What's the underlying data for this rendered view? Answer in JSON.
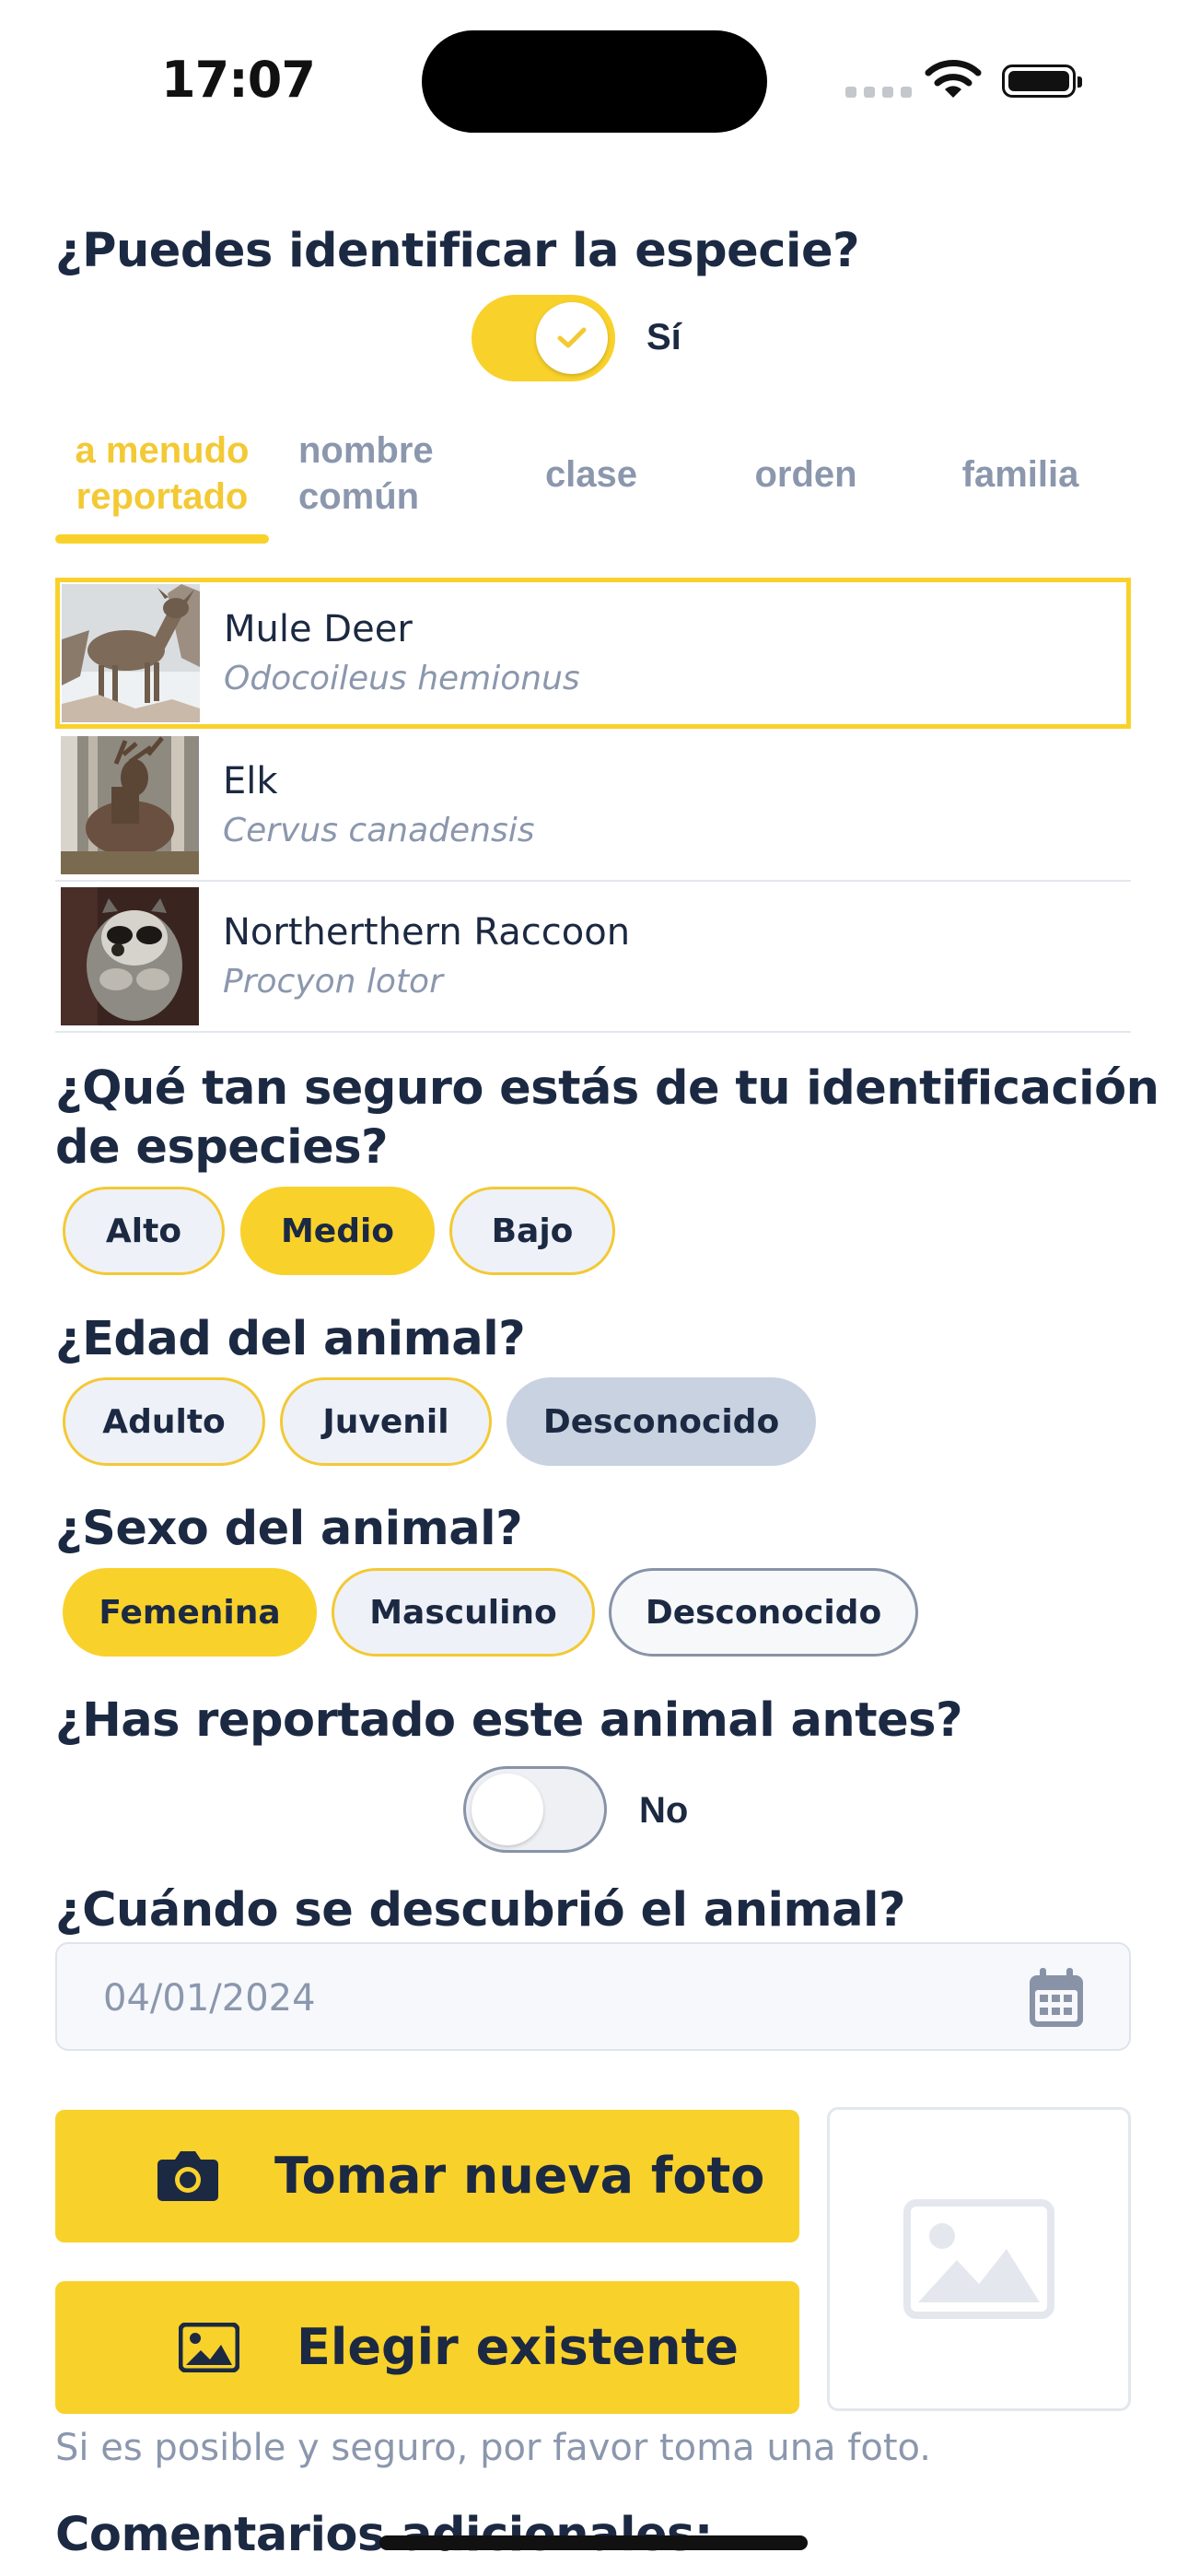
{
  "status_bar": {
    "time": "17:07"
  },
  "identify": {
    "question": "¿Puedes identificar la especie?",
    "toggle_on": true,
    "toggle_label": "Sí"
  },
  "tabs": [
    {
      "line1": "a menudo",
      "line2": "reportado",
      "active": true
    },
    {
      "line1": "nombre",
      "line2": "común",
      "active": false
    },
    {
      "label": "clase",
      "active": false
    },
    {
      "label": "orden",
      "active": false
    },
    {
      "label": "familia",
      "active": false
    }
  ],
  "species": [
    {
      "name": "Mule Deer",
      "scientific": "Odocoileus hemionus",
      "selected": true
    },
    {
      "name": "Elk",
      "scientific": "Cervus canadensis",
      "selected": false
    },
    {
      "name": "Northerthern Raccoon",
      "scientific": "Procyon lotor",
      "selected": false
    }
  ],
  "confidence": {
    "question_line1": "¿Qué tan seguro estás de tu identificación",
    "question_line2": "de especies?",
    "options": [
      "Alto",
      "Medio",
      "Bajo"
    ],
    "selected": "Medio"
  },
  "age": {
    "question": "¿Edad del animal?",
    "options": [
      "Adulto",
      "Juvenil",
      "Desconocido"
    ],
    "selected": "Desconocido"
  },
  "sex": {
    "question": "¿Sexo del animal?",
    "options": [
      "Femenina",
      "Masculino",
      "Desconocido"
    ],
    "selected": "Femenina"
  },
  "reported_before": {
    "question": "¿Has reportado este animal antes?",
    "toggle_on": false,
    "toggle_label": "No"
  },
  "discovered": {
    "question": "¿Cuándo se descubrió el animal?",
    "date": "04/01/2024"
  },
  "photo": {
    "take_label": "Tomar nueva foto",
    "choose_label": "Elegir existente",
    "hint": "Si es posible y seguro, por favor toma una foto."
  },
  "comments": {
    "question": "Comentarios adicionales:"
  },
  "colors": {
    "accent": "#f9d12b",
    "text_dark": "#1c2942",
    "text_muted": "#8b97ad",
    "pill_grey": "#c9d2e1"
  }
}
